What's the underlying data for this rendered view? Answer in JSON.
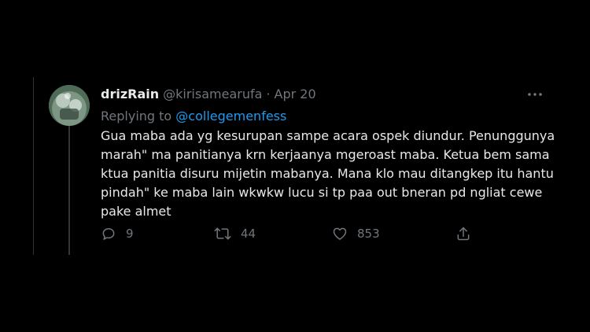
{
  "tweet": {
    "display_name": "drizRain",
    "handle": "@kirisamearufa",
    "separator": "·",
    "date": "Apr 20",
    "replying_prefix": "Replying to",
    "replying_to": "@collegemenfess",
    "text_lines": [
      "Gua maba ada yg kesurupan sampe acara ospek diundur. Penunggunya",
      "marah\" ma panitianya krn kerjaanya mgeroast maba. Ketua bem sama",
      "ktua panitia disuru mijetin mabanya. Mana klo mau ditangkep itu hantu",
      "pindah\" ke maba lain wkwkw lucu si tp paa out bneran pd ngliat cewe",
      "pake almet"
    ],
    "actions": {
      "reply_count": "9",
      "retweet_count": "44",
      "like_count": "853"
    }
  },
  "icons": {
    "more": "more-horizontal-icon",
    "reply": "reply-icon",
    "retweet": "retweet-icon",
    "like": "heart-icon",
    "share": "share-icon"
  },
  "colors": {
    "background": "#000000",
    "text_primary": "#e7e9ea",
    "text_secondary": "#71767b",
    "link": "#1d9bf0"
  }
}
